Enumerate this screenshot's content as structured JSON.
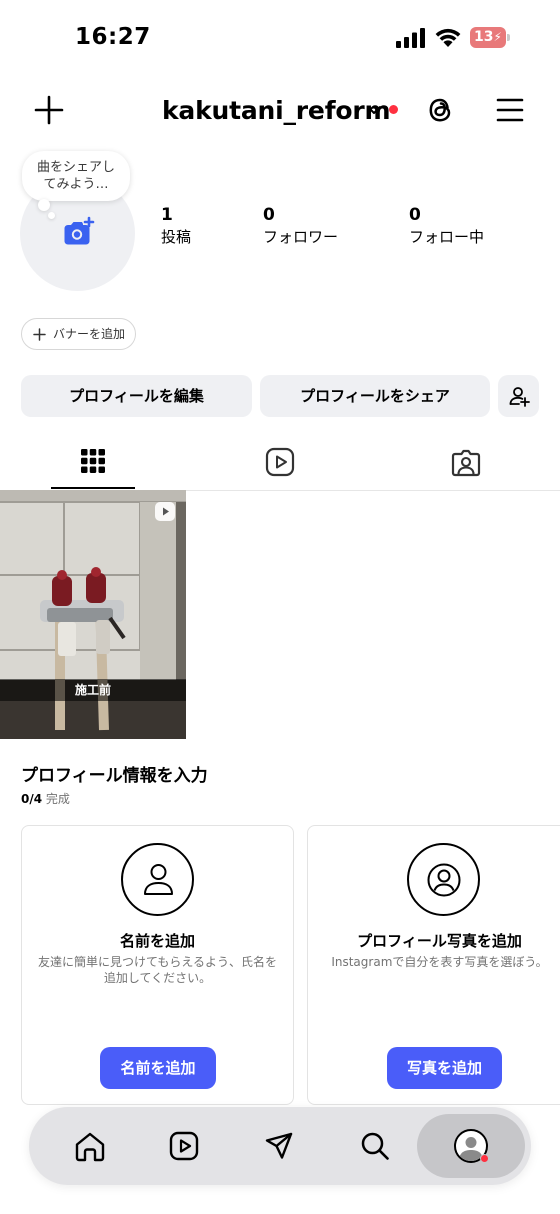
{
  "status_bar": {
    "time": "16:27",
    "battery": "13"
  },
  "header": {
    "username": "kakutani_reform",
    "icons": [
      "plus-icon",
      "chevron-down-icon",
      "threads-icon",
      "menu-icon"
    ],
    "notification_dot_color": "#ff3040"
  },
  "profile": {
    "note": "曲をシェアし\nてみよう…",
    "stats": [
      {
        "num": "1",
        "label": "投稿"
      },
      {
        "num": "0",
        "label": "フォロワー"
      },
      {
        "num": "0",
        "label": "フォロー中"
      }
    ],
    "banner_label": "バナーを追加",
    "edit_label": "プロフィールを編集",
    "share_label": "プロフィールをシェア"
  },
  "tabs": [
    "grid-icon",
    "reels-icon",
    "tagged-icon"
  ],
  "post": {
    "caption": "施工前"
  },
  "completion": {
    "title": "プロフィール情報を入力",
    "count": "0/4",
    "status": "完成",
    "cards": [
      {
        "title": "名前を追加",
        "desc": "友達に簡単に見つけてもらえるよう、氏名を追加してください。",
        "button": "名前を追加"
      },
      {
        "title": "プロフィール写真を追加",
        "desc": "Instagramで自分を表す写真を選ぼう。",
        "button": "写真を追加"
      }
    ]
  },
  "bottom_nav": [
    "home-icon",
    "reels-icon",
    "messages-icon",
    "search-icon",
    "profile-avatar"
  ],
  "colors": {
    "accent": "#4a5df9",
    "notification": "#ff3040",
    "surface": "#eff0f3"
  }
}
